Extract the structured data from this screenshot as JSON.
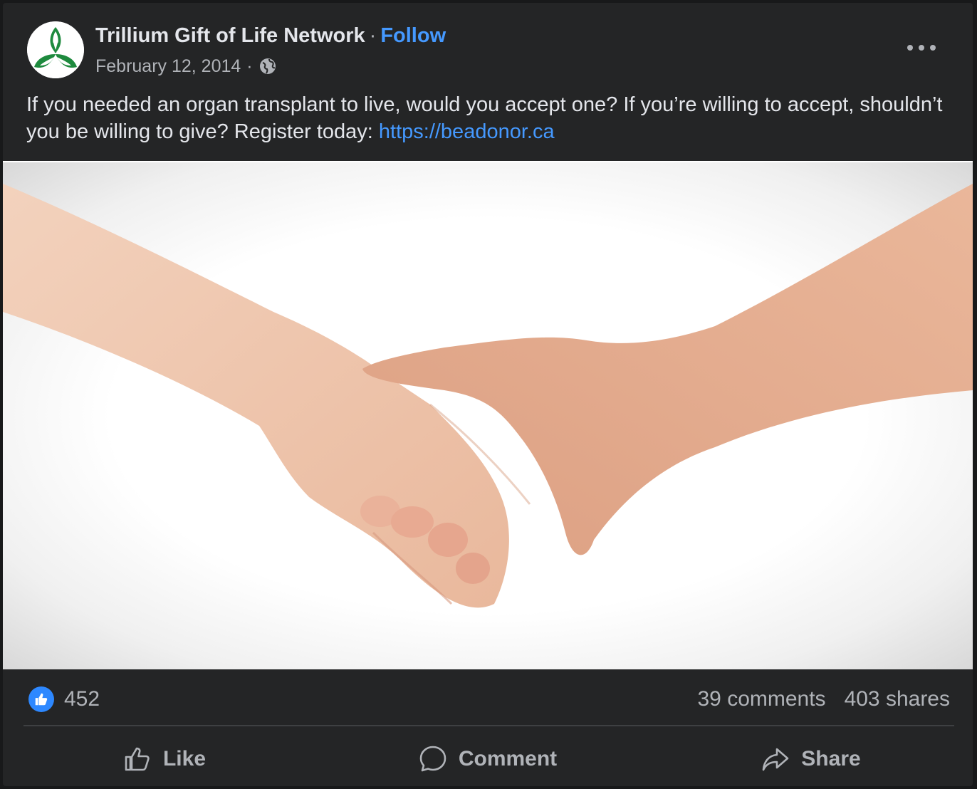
{
  "post": {
    "page_name": "Trillium Gift of Life Network",
    "separator": "·",
    "follow_label": "Follow",
    "date": "February 12, 2014",
    "meta_separator": "·",
    "privacy_icon": "globe-icon",
    "more_icon": "more-horizontal-icon",
    "caption_text": "If you needed an organ transplant to live, would you accept one?  If you’re willing to accept, shouldn’t you be willing to give? Register today: ",
    "caption_link": "https://beadonor.ca"
  },
  "stats": {
    "reaction_icon": "like-reaction-icon",
    "like_count": "452",
    "comments": "39 comments",
    "shares": "403 shares"
  },
  "actions": {
    "like_label": "Like",
    "comment_label": "Comment",
    "share_label": "Share"
  },
  "colors": {
    "background": "#242526",
    "text": "#e4e6eb",
    "secondary_text": "#b0b3b8",
    "link": "#4599ff",
    "like_badge": "#2d88ff",
    "logo_green": "#1e8a3e"
  }
}
